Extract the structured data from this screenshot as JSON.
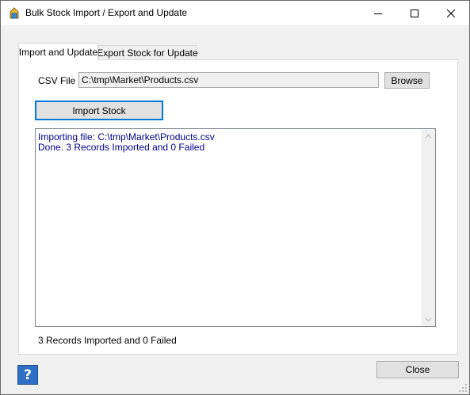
{
  "window": {
    "title": "Bulk Stock Import / Export and Update",
    "icon": "stock-app-icon",
    "controls": [
      "minimize-icon",
      "maximize-icon",
      "close-icon"
    ]
  },
  "tabs": [
    {
      "label": "Import and Update",
      "active": true
    },
    {
      "label": "Export Stock for Update",
      "active": false
    }
  ],
  "import_tab": {
    "csv_label": "CSV File",
    "csv_path": "C:\\tmp\\Market\\Products.csv",
    "browse_label": "Browse",
    "import_label": "Import Stock",
    "log_lines": [
      "Importing file: C:\\tmp\\Market\\Products.csv",
      "Done. 3 Records Imported and 0 Failed"
    ],
    "status": "3 Records Imported and 0 Failed"
  },
  "footer": {
    "help_label": "?",
    "close_label": "Close"
  },
  "colors": {
    "log_text": "#00008b",
    "focus_border": "#0078d7",
    "help_button": "#2f6fc4"
  }
}
